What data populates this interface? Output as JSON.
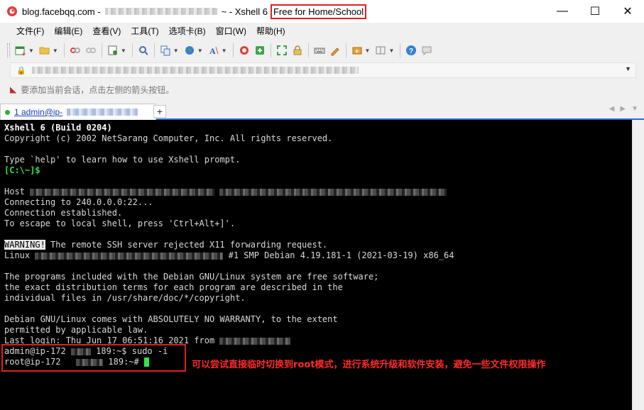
{
  "window": {
    "title_prefix": "blog.facebqq.com -",
    "title_mid": "~ - Xshell 6",
    "title_highlight": "Free for Home/School",
    "minimize": "—",
    "maximize": "☐",
    "close": "✕"
  },
  "menu": [
    "文件(F)",
    "编辑(E)",
    "查看(V)",
    "工具(T)",
    "选项卡(B)",
    "窗口(W)",
    "帮助(H)"
  ],
  "toolbar": {
    "icons": [
      "new-session-icon",
      "open-folder-icon",
      "connect-icon",
      "disconnect-icon",
      "properties-icon",
      "find-icon",
      "copy-paste-icon",
      "globe-icon",
      "font-icon",
      "xshell-icon",
      "xftp-icon",
      "fullscreen-icon",
      "lock-icon",
      "keyboard-icon",
      "highlight-icon",
      "compose-icon",
      "layout-icon",
      "help-icon",
      "chat-icon"
    ]
  },
  "hint": "要添加当前会话，点击左侧的箭头按钮。",
  "tab": {
    "label": "1 admin@ip-",
    "add": "+"
  },
  "terminal": {
    "build": "Xshell 6 (Build 0204)",
    "copyright": "Copyright (c) 2002 NetSarang Computer, Inc. All rights reserved.",
    "help": "Type `help' to learn how to use Xshell prompt.",
    "local_prompt": "[C:\\~]$",
    "host": "Host",
    "connecting": "Connecting to 240.0.0.0:22...",
    "established": "Connection established.",
    "escape": "To escape to local shell, press 'Ctrl+Alt+]'.",
    "warning_tag": "WARNING!",
    "warning_msg": " The remote SSH server rejected X11 forwarding request.",
    "linux": "Linux",
    "kernel": "#1 SMP Debian 4.19.181-1 (2021-03-19) x86_64",
    "programs1": "The programs included with the Debian GNU/Linux system are free software;",
    "programs2": "the exact distribution terms for each program are described in the",
    "programs3": "individual files in /usr/share/doc/*/copyright.",
    "warranty1": "Debian GNU/Linux comes with ABSOLUTELY NO WARRANTY, to the extent",
    "warranty2": "permitted by applicable law.",
    "last_login": "Last login: Thu Jun 17 06:51:16 2021 from",
    "prompt1_a": "admin@ip-172",
    "prompt1_b": "189:~$ sudo -i",
    "prompt2_a": "root@ip-172",
    "prompt2_b": "189:~#"
  },
  "annotation": "可以尝试直接临时切换到root模式，进行系统升级和软件安装，避免一些文件权限操作",
  "colors": {
    "accent": "#2a6ad0",
    "annotation": "#ff2a2a",
    "prompt_green": "#2ee64a"
  }
}
